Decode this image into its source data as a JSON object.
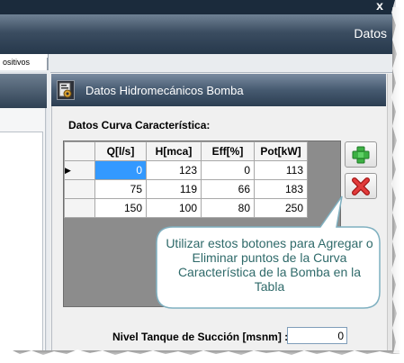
{
  "window": {
    "close_symbol": "x",
    "header_title": "Datos"
  },
  "tabs": [
    {
      "label": "ositivos"
    }
  ],
  "panel": {
    "title": "Datos Hidromecánicos Bomba",
    "icon": "gear-document-icon",
    "section_label": "Datos Curva Característica:"
  },
  "grid": {
    "columns": [
      "Q[l/s]",
      "H[mca]",
      "Eff[%]",
      "Pot[kW]"
    ],
    "rows": [
      {
        "indicator": "▶",
        "cells": [
          "0",
          "123",
          "0",
          "113"
        ]
      },
      {
        "indicator": "",
        "cells": [
          "75",
          "119",
          "66",
          "183"
        ]
      },
      {
        "indicator": "",
        "cells": [
          "150",
          "100",
          "80",
          "250"
        ]
      }
    ]
  },
  "buttons": {
    "add_icon": "green-plus-icon",
    "remove_icon": "red-x-icon"
  },
  "callout": {
    "text": "Utilizar estos botones para Agregar o Eliminar puntos de la Curva Característica de la Bomba en la Tabla"
  },
  "suction": {
    "label": "Nivel Tanque de Succión [msnm] :",
    "value": "0"
  },
  "colors": {
    "header_dark": "#1b2b3c",
    "selection": "#3399ff",
    "callout_fill": "#ffffff",
    "callout_stroke": "#7fb0c0",
    "callout_text": "#2f6a6a"
  }
}
